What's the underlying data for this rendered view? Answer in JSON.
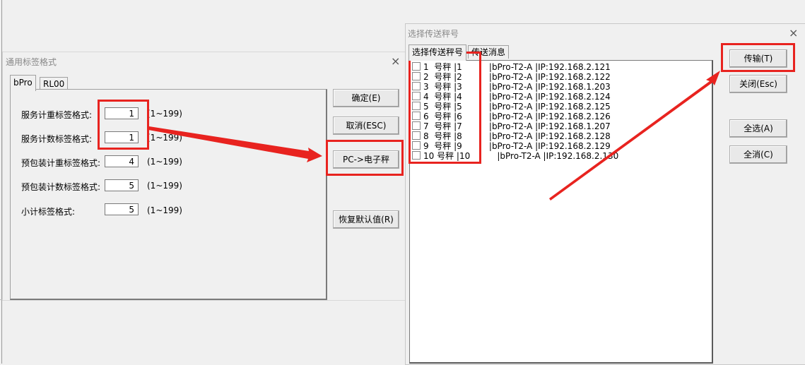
{
  "dialog1": {
    "title": "通用标签格式",
    "tabs": [
      "bPro",
      "RL00"
    ],
    "fields": [
      {
        "label": "服务计重标签格式:",
        "value": "1",
        "range": "(1~199)"
      },
      {
        "label": "服务计数标签格式:",
        "value": "1",
        "range": "(1~199)"
      },
      {
        "label": "预包装计重标签格式:",
        "value": "4",
        "range": "(1~199)"
      },
      {
        "label": "预包装计数标签格式:",
        "value": "5",
        "range": "(1~199)"
      },
      {
        "label": "小计标签格式:",
        "value": "5",
        "range": "(1~199)"
      }
    ],
    "buttons": {
      "ok": "确定(E)",
      "cancel": "取消(ESC)",
      "pc_to_scale": "PC->电子秤",
      "restore": "恢复默认值(R)"
    },
    "close": "×"
  },
  "dialog2": {
    "title": "选择传送秤号",
    "tabs": [
      "选择传送秤号",
      "传送消息"
    ],
    "scales": [
      "1  号秤 |1          |bPro-T2-A |IP:192.168.2.121",
      "2  号秤 |2          |bPro-T2-A |IP:192.168.2.122",
      "3  号秤 |3          |bPro-T2-A |IP:192.168.1.203",
      "4  号秤 |4          |bPro-T2-A |IP:192.168.2.124",
      "5  号秤 |5          |bPro-T2-A |IP:192.168.2.125",
      "6  号秤 |6          |bPro-T2-A |IP:192.168.2.126",
      "7  号秤 |7          |bPro-T2-A |IP:192.168.1.207",
      "8  号秤 |8          |bPro-T2-A |IP:192.168.2.128",
      "9  号秤 |9          |bPro-T2-A |IP:192.168.2.129",
      "10 号秤 |10          |bPro-T2-A |IP:192.168.2.130"
    ],
    "buttons": {
      "transfer": "传输(T)",
      "close": "关闭(Esc)",
      "select_all": "全选(A)",
      "deselect_all": "全消(C)"
    },
    "close": "×"
  },
  "colors": {
    "highlight": "#e8231f",
    "arrow": "#e8231f"
  }
}
